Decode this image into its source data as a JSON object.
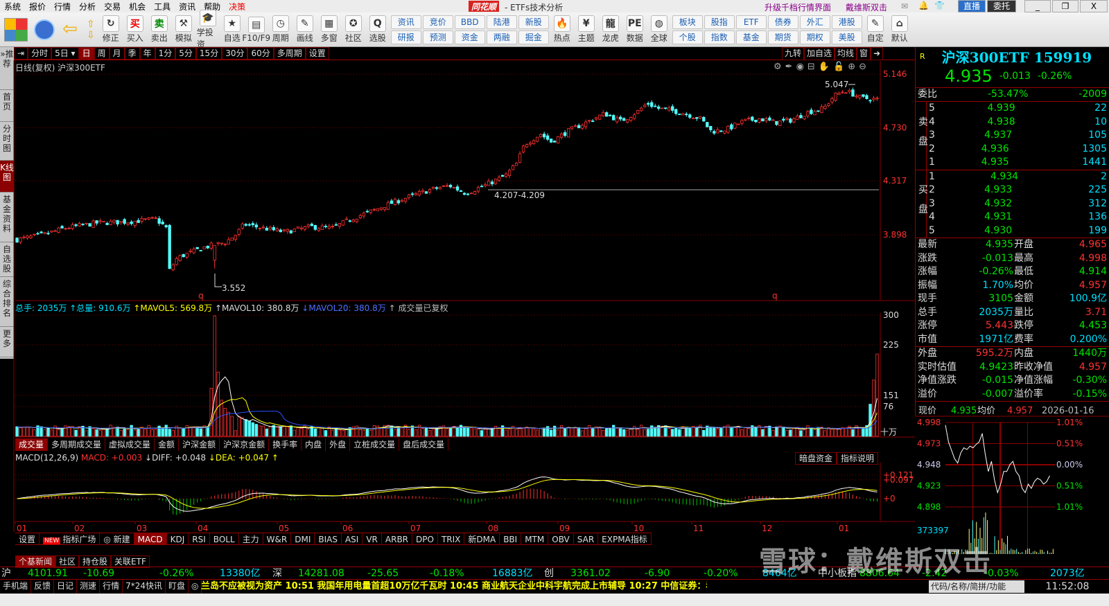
{
  "menu": [
    "系统",
    "报价",
    "行情",
    "分析",
    "交易",
    "机会",
    "工具",
    "资讯",
    "帮助",
    "决策"
  ],
  "app": {
    "logo": "同花顺",
    "title": "- ETFs技术分析",
    "upgrade": "升级千档行情界面",
    "user": "戴维斯双击",
    "live": "直播",
    "entrust": "委托",
    "min": "_",
    "max": "❐",
    "close": "X"
  },
  "toolbar": {
    "icons1": [
      {
        "l": "修正",
        "g": "↻"
      },
      {
        "l": "买入",
        "g": "买"
      },
      {
        "l": "卖出",
        "g": "卖"
      },
      {
        "l": "模拟",
        "g": "⚒"
      },
      {
        "l": "学投资",
        "g": "🎓"
      },
      {
        "l": "自选",
        "g": "★"
      },
      {
        "l": "F10/F9",
        "g": "▤"
      },
      {
        "l": "周期",
        "g": "◷"
      },
      {
        "l": "画线",
        "g": "✎"
      },
      {
        "l": "多窗",
        "g": "▦"
      },
      {
        "l": "社区",
        "g": "✪"
      },
      {
        "l": "选股",
        "g": "Q"
      }
    ],
    "grid1": [
      "资讯",
      "研报",
      "竞价",
      "预测",
      "BBD",
      "资金",
      "陆港",
      "两融",
      "新股",
      "掘金"
    ],
    "icons2": [
      {
        "l": "热点",
        "g": "🔥"
      },
      {
        "l": "主题",
        "g": "¥"
      },
      {
        "l": "龙虎",
        "g": "龍"
      },
      {
        "l": "数据",
        "g": "PE"
      },
      {
        "l": "全球",
        "g": "◍"
      }
    ],
    "grid2": [
      "板块",
      "个股",
      "股指",
      "指数",
      "ETF",
      "基金",
      "债券",
      "期货",
      "外汇",
      "期权",
      "港股",
      "美股"
    ],
    "icons3": [
      {
        "l": "自定",
        "g": "✎"
      },
      {
        "l": "默认",
        "g": "⌂"
      }
    ]
  },
  "sidebar": [
    "»推荐",
    "首页",
    "分时图",
    "K线图",
    "基金资料",
    "自选股",
    "综合排名",
    "更多"
  ],
  "periods": [
    "分时",
    "5日 ▾",
    "日",
    "周",
    "月",
    "季",
    "年",
    "1分",
    "5分",
    "15分",
    "30分",
    "60分",
    "多周期",
    "设置"
  ],
  "period_active": 2,
  "right_buttons": [
    "九转",
    "加自选",
    "均线",
    "窗",
    "➜"
  ],
  "chart": {
    "title": "日线(复权)  沪深300ETF",
    "price_ticks": [
      {
        "v": "5.146",
        "p": 5.146
      },
      {
        "v": "4.730",
        "p": 4.73
      },
      {
        "v": "4.317",
        "p": 4.317
      },
      {
        "v": "3.898",
        "p": 3.898
      }
    ],
    "high_label": "5.047",
    "low_label": "3.552",
    "range_label": "4.207-4.209",
    "q_marker": "q",
    "months": [
      "01",
      "02",
      "03",
      "04",
      "05",
      "06",
      "07",
      "08",
      "09",
      "10",
      "11",
      "12",
      "01"
    ],
    "anchors": [
      [
        0,
        3.86
      ],
      [
        10,
        3.9
      ],
      [
        18,
        3.95
      ],
      [
        30,
        3.99
      ],
      [
        42,
        4.0
      ],
      [
        52,
        4.02
      ],
      [
        56,
        3.95
      ],
      [
        57,
        3.62
      ],
      [
        60,
        3.72
      ],
      [
        70,
        3.8
      ],
      [
        78,
        3.84
      ],
      [
        82,
        3.9
      ],
      [
        85,
        3.98
      ],
      [
        92,
        3.95
      ],
      [
        100,
        3.92
      ],
      [
        110,
        3.96
      ],
      [
        118,
        3.95
      ],
      [
        125,
        4.02
      ],
      [
        135,
        4.1
      ],
      [
        145,
        4.18
      ],
      [
        155,
        4.25
      ],
      [
        162,
        4.28
      ],
      [
        137,
        4.12
      ],
      [
        168,
        4.22
      ],
      [
        175,
        4.28
      ],
      [
        183,
        4.36
      ],
      [
        187,
        4.45
      ],
      [
        190,
        4.6
      ],
      [
        196,
        4.68
      ],
      [
        200,
        4.62
      ],
      [
        206,
        4.7
      ],
      [
        214,
        4.78
      ],
      [
        220,
        4.84
      ],
      [
        226,
        4.78
      ],
      [
        232,
        4.85
      ],
      [
        236,
        4.92
      ],
      [
        240,
        4.88
      ],
      [
        246,
        4.86
      ],
      [
        250,
        4.84
      ],
      [
        256,
        4.8
      ],
      [
        260,
        4.7
      ],
      [
        266,
        4.72
      ],
      [
        272,
        4.78
      ],
      [
        278,
        4.8
      ],
      [
        284,
        4.77
      ],
      [
        290,
        4.79
      ],
      [
        296,
        4.85
      ],
      [
        302,
        4.88
      ],
      [
        306,
        4.98
      ],
      [
        310,
        5.02
      ],
      [
        316,
        4.96
      ],
      [
        322,
        4.95
      ]
    ],
    "volume_label": "总手: 2035万",
    "vol_total": "↑总量: 910.6万",
    "mavol5": "↑MAVOL5: 569.8万",
    "mavol10": "↑MAVOL10: 380.8万",
    "mavol20": "↓MAVOL20: 380.8万",
    "vol_note": "↑ 成交量已复权",
    "vol_ticks": [
      "300",
      "225",
      "151",
      "76",
      "十万"
    ],
    "vol_tabs": [
      "成交量",
      "多周期成交量",
      "虚拟成交量",
      "金额",
      "沪深金额",
      "沪深京金额",
      "换手率",
      "内盘",
      "外盘",
      "立桩成交量",
      "盘后成交量"
    ],
    "macd_label": "MACD(12,26,9)",
    "macd_val": "MACD: +0.003",
    "diff_val": "↓DIFF: +0.048",
    "dea_val": "↓DEA: +0.047 ↑",
    "macd_ticks": [
      "+0.121",
      "+0.097",
      "+0"
    ],
    "macd_buttons": [
      "暗盘资金",
      "指标说明"
    ],
    "ind_tabs": [
      "设置",
      "NEW",
      "指标广场",
      "◎ 新建",
      "MACD",
      "KDJ",
      "RSI",
      "BOLL",
      "主力",
      "W&R",
      "DMI",
      "BIAS",
      "ASI",
      "VR",
      "ARBR",
      "DPO",
      "TRIX",
      "新DMA",
      "BBI",
      "MTM",
      "OBV",
      "SAR",
      "EXPMA指标"
    ]
  },
  "quote": {
    "flag": "R",
    "name": "沪深300ETF 159919",
    "price": "4.935",
    "change": "-0.013",
    "pct": "-0.26%",
    "weibi_label": "委比",
    "weibi": "-53.47%",
    "weicha": "-2009",
    "sell_label": "卖盘",
    "buy_label": "买盘",
    "sell": [
      [
        "5",
        "4.939",
        "22"
      ],
      [
        "4",
        "4.938",
        "10"
      ],
      [
        "3",
        "4.937",
        "105"
      ],
      [
        "2",
        "4.936",
        "1305"
      ],
      [
        "1",
        "4.935",
        "1441"
      ]
    ],
    "buy": [
      [
        "1",
        "4.934",
        "2"
      ],
      [
        "2",
        "4.933",
        "225"
      ],
      [
        "3",
        "4.932",
        "312"
      ],
      [
        "4",
        "4.931",
        "136"
      ],
      [
        "5",
        "4.930",
        "199"
      ]
    ],
    "stats": [
      [
        "最新",
        "4.935",
        "g",
        "开盘",
        "4.965",
        "r"
      ],
      [
        "涨跌",
        "-0.013",
        "g",
        "最高",
        "4.998",
        "r"
      ],
      [
        "涨幅",
        "-0.26%",
        "g",
        "最低",
        "4.914",
        "g"
      ],
      [
        "振幅",
        "1.70%",
        "c",
        "均价",
        "4.957",
        "r"
      ],
      [
        "现手",
        "3105",
        "g",
        "金额",
        "100.9亿",
        "c"
      ],
      [
        "总手",
        "2035万",
        "c",
        "量比",
        "3.71",
        "r"
      ],
      [
        "涨停",
        "5.443",
        "r",
        "跌停",
        "4.453",
        "g"
      ],
      [
        "市值",
        "1971亿",
        "c",
        "费率",
        "0.200%",
        "c"
      ]
    ],
    "stats2": [
      [
        "外盘",
        "595.2万",
        "r",
        "内盘",
        "1440万",
        "g"
      ],
      [
        "实时估值",
        "4.9423",
        "g",
        "昨收净值",
        "4.957",
        "r"
      ],
      [
        "净值涨跌",
        "-0.015",
        "g",
        "净值涨幅",
        "-0.30%",
        "g"
      ],
      [
        "溢价",
        "-0.007",
        "g",
        "溢价率",
        "-0.15%",
        "g"
      ]
    ]
  },
  "intraday": {
    "now_label": "现价",
    "now": "4.935",
    "avg_label": "均价",
    "avg": "4.957",
    "date": "2026-01-16",
    "left_ticks": [
      "4.998",
      "4.973",
      "4.948",
      "4.923",
      "4.898"
    ],
    "right_ticks": [
      "1.01%",
      "0.51%",
      "0.00%",
      "0.51%",
      "1.01%"
    ],
    "vol_tick": "373397",
    "prices": [
      4.995,
      4.975,
      4.965,
      4.955,
      4.95,
      4.962,
      4.968,
      4.966,
      4.97,
      4.968,
      4.972,
      4.975,
      4.985,
      4.96,
      4.94,
      4.952,
      4.93,
      4.915,
      4.925,
      4.94,
      4.94,
      4.948,
      4.952,
      4.94,
      4.935,
      4.92,
      4.915,
      4.925,
      4.92,
      4.928,
      4.932,
      4.93,
      4.925,
      4.928,
      4.935
    ]
  },
  "news_tabs": [
    "个基新闻",
    "社区",
    "持仓股",
    "关联ETF"
  ],
  "indices": [
    {
      "n": "沪",
      "v": "4101.91",
      "c": "-10.69",
      "p": "-0.26%",
      "a": "13380亿"
    },
    {
      "n": "深",
      "v": "14281.08",
      "c": "-25.65",
      "p": "-0.18%",
      "a": "16883亿"
    },
    {
      "n": "创",
      "v": "3361.02",
      "c": "-6.90",
      "p": "-0.20%",
      "a": "8464亿"
    },
    {
      "n": "中小板指",
      "v": "8806.64",
      "c": "-2.42",
      "p": "-0.03%",
      "a": "2073亿"
    }
  ],
  "status": [
    "手机端",
    "反馈",
    "日记",
    "测速",
    "行情",
    "7*24快讯",
    "盯盘",
    "◎"
  ],
  "ticker": "兰岛不应被视为资产          10:51 我国年用电量首超10万亿千瓦时          10:45 商业航天企业中科宇航完成上市辅导          10:27 中信证券：看好半导体设备的投资",
  "search_placeholder": "代码/名称/简拼/功能",
  "clock": "11:52:08",
  "watermark": "雪球：戴维斯双击",
  "colors": {
    "up": "#ff3232",
    "down": "#54ffff",
    "grid": "#8b0000",
    "ma_white": "#ffffff",
    "ma_yellow": "#ffff00",
    "ma_blue": "#3050ff"
  }
}
